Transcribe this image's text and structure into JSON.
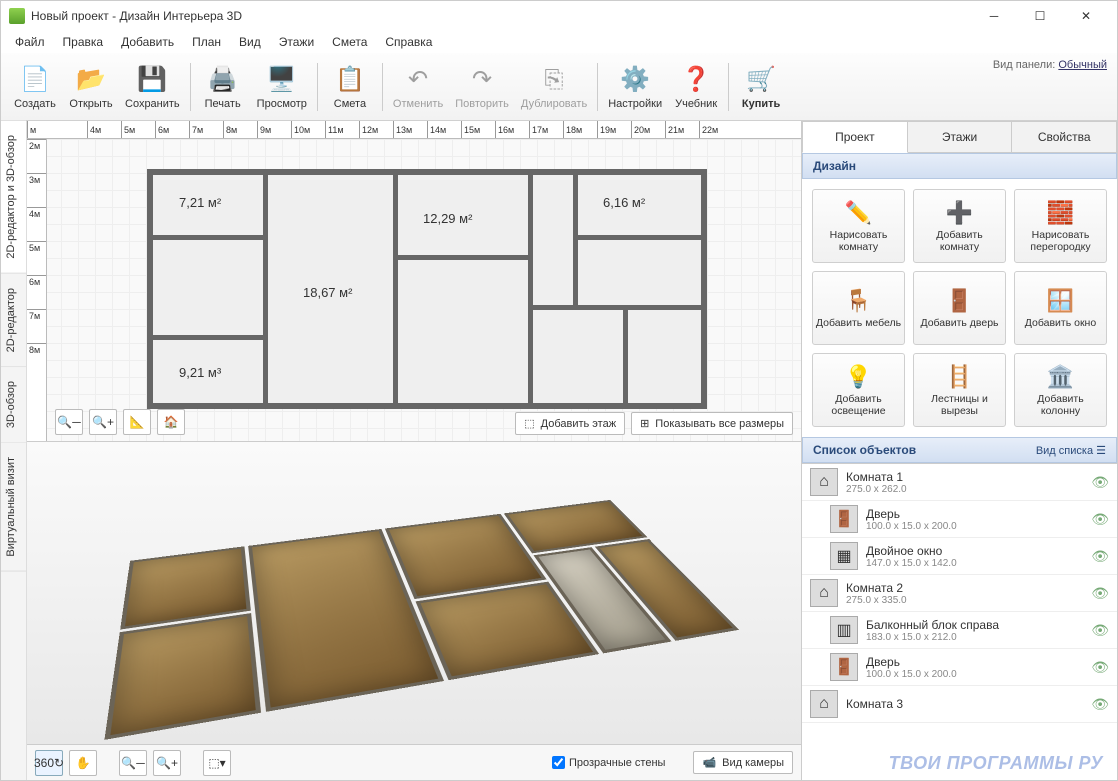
{
  "window": {
    "title": "Новый проект - Дизайн Интерьера 3D"
  },
  "menu": [
    "Файл",
    "Правка",
    "Добавить",
    "План",
    "Вид",
    "Этажи",
    "Смета",
    "Справка"
  ],
  "panel_mode": {
    "label": "Вид панели:",
    "value": "Обычный"
  },
  "toolbar": {
    "create": "Создать",
    "open": "Открыть",
    "save": "Сохранить",
    "print": "Печать",
    "preview": "Просмотр",
    "estimate": "Смета",
    "undo": "Отменить",
    "redo": "Повторить",
    "duplicate": "Дублировать",
    "settings": "Настройки",
    "tutorial": "Учебник",
    "buy": "Купить"
  },
  "sidetabs": {
    "t0": "2D-редактор и 3D-обзор",
    "t1": "2D-редактор",
    "t2": "3D-обзор",
    "t3": "Виртуальный визит"
  },
  "ruler_h": [
    "м",
    "4м",
    "5м",
    "6м",
    "7м",
    "8м",
    "9м",
    "10м",
    "11м",
    "12м",
    "13м",
    "14м",
    "15м",
    "16м",
    "17м",
    "18м",
    "19м",
    "20м",
    "21м",
    "22м"
  ],
  "ruler_v": [
    "2м",
    "3м",
    "4м",
    "5м",
    "6м",
    "7м",
    "8м"
  ],
  "rooms": {
    "r1": "7,21 м²",
    "r2": "18,67 м²",
    "r3": "12,29 м²",
    "r4": "6,16 м²",
    "r5": "9,21 м³"
  },
  "plan_actions": {
    "add_floor": "Добавить этаж",
    "show_dims": "Показывать все размеры"
  },
  "bottom": {
    "transparent_walls": "Прозрачные стены",
    "camera": "Вид камеры"
  },
  "right_tabs": {
    "project": "Проект",
    "floors": "Этажи",
    "props": "Свойства"
  },
  "design_hdr": "Дизайн",
  "tools": {
    "draw_room": "Нарисовать комнату",
    "add_room": "Добавить комнату",
    "draw_partition": "Нарисовать перегородку",
    "add_furniture": "Добавить мебель",
    "add_door": "Добавить дверь",
    "add_window": "Добавить окно",
    "add_light": "Добавить освещение",
    "stairs": "Лестницы и вырезы",
    "add_column": "Добавить колонну"
  },
  "objlist_hdr": "Список объектов",
  "objlist_view": "Вид списка",
  "objects": [
    {
      "name": "Комната 1",
      "dims": "275.0 x 262.0",
      "ic": "⌂",
      "sub": false
    },
    {
      "name": "Дверь",
      "dims": "100.0 x 15.0 x 200.0",
      "ic": "🚪",
      "sub": true
    },
    {
      "name": "Двойное окно",
      "dims": "147.0 x 15.0 x 142.0",
      "ic": "▦",
      "sub": true
    },
    {
      "name": "Комната 2",
      "dims": "275.0 x 335.0",
      "ic": "⌂",
      "sub": false
    },
    {
      "name": "Балконный блок справа",
      "dims": "183.0 x 15.0 x 212.0",
      "ic": "▥",
      "sub": true
    },
    {
      "name": "Дверь",
      "dims": "100.0 x 15.0 x 200.0",
      "ic": "🚪",
      "sub": true
    },
    {
      "name": "Комната 3",
      "dims": "",
      "ic": "⌂",
      "sub": false
    }
  ],
  "watermark": "ТВОИ ПРОГРАММЫ РУ"
}
